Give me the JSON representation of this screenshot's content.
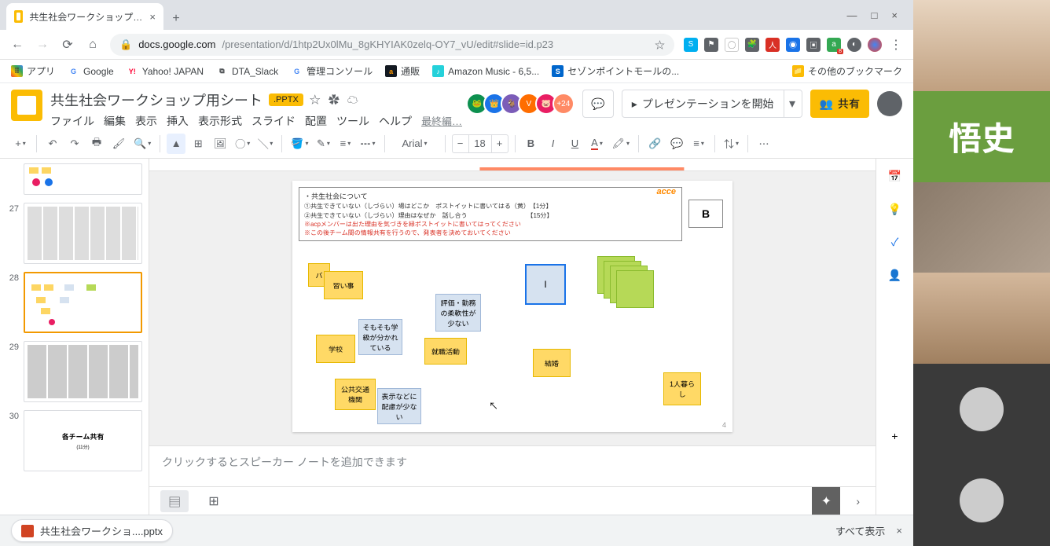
{
  "browser": {
    "tab_title": "共生社会ワークショップ用シート.pptx",
    "url_host": "docs.google.com",
    "url_path": "/presentation/d/1htp2Ux0lMu_8gKHYIAK0zelq-OY7_vU/edit#slide=id.p23",
    "bookmarks": {
      "apps": "アプリ",
      "google": "Google",
      "yahoo": "Yahoo! JAPAN",
      "slack": "DTA_Slack",
      "admin": "管理コンソール",
      "amazon": "通販",
      "amazonmusic": "Amazon Music - 6,5...",
      "sezon": "セゾンポイントモールの...",
      "other": "その他のブックマーク"
    }
  },
  "doc": {
    "title": "共生社会ワークショップ用シート",
    "format_badge": ".PPTX",
    "menus": {
      "file": "ファイル",
      "edit": "編集",
      "view": "表示",
      "insert": "挿入",
      "format": "表示形式",
      "slide": "スライド",
      "arrange": "配置",
      "tools": "ツール",
      "help": "ヘルプ"
    },
    "last_edit": "最終編…",
    "collab_more": "+24",
    "present": "プレゼンテーションを開始",
    "share": "共有"
  },
  "toolbar": {
    "font": "Arial",
    "size": "18"
  },
  "thumbs": {
    "n27": "27",
    "n28": "28",
    "n29": "29",
    "n30": "30",
    "s30_title": "各チーム共有",
    "s30_sub": "(11分)"
  },
  "slide": {
    "title": "・共生社会について",
    "l1": "①共生できていない（しづらい）場はどこか　ポストイットに書いてはる（黄）　【1分】",
    "l2": "②共生できていない（しづらい）理由はなぜか　話し合う　　　　　　　　　　【15分】",
    "l3": "※acpメンバーは出た理由を気づきを緑ポストイットに書いてはってください",
    "l4": "※この後チーム間の情報共有を行うので、発表者を決めておいてください",
    "logo": "acce",
    "group": "B",
    "notes": {
      "ba": "バ",
      "naraigoto": "習い事",
      "gakko": "学校",
      "kokyo": "公共交通機関",
      "somosomo": "そもそも学級が分かれている",
      "hyoji": "表示などに配慮が少ない",
      "hyoka": "評価・勤務の柔軟性が少ない",
      "shushoku": "就職活動",
      "i": "I",
      "kekkon": "結婚",
      "hitori": "1人暮らし"
    },
    "page": "4"
  },
  "speaker_notes": "クリックするとスピーカー ノートを追加できます",
  "bottom": {
    "download": "共生社会ワークショ....pptx",
    "showall": "すべて表示"
  },
  "zoom": {
    "label": "悟史"
  }
}
